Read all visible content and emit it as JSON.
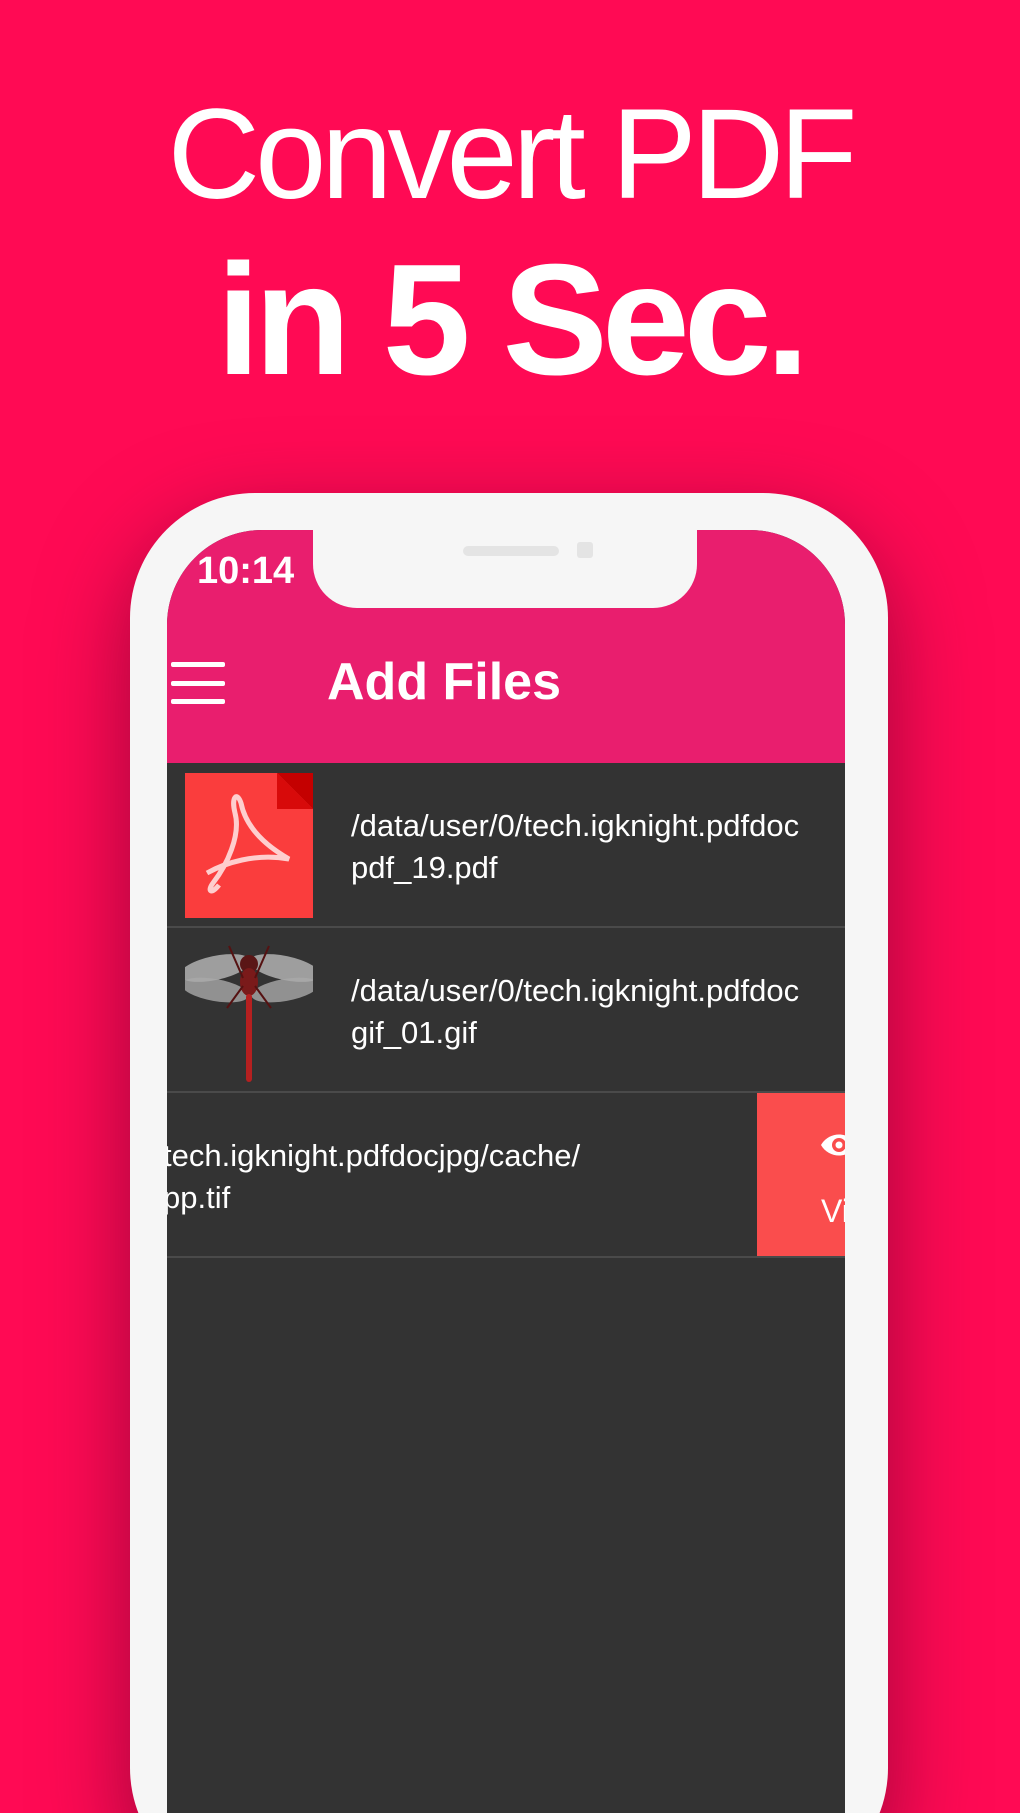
{
  "headline": {
    "line1": "Convert PDF",
    "line2": "in 5 Sec."
  },
  "statusbar": {
    "time": "10:14"
  },
  "toolbar": {
    "title": "Add Files",
    "menu_icon": "hamburger-icon"
  },
  "files": [
    {
      "thumb": "pdf-file-icon",
      "line1": "/data/user/0/tech.igknight.pdfdoc",
      "line2": "pdf_19.pdf"
    },
    {
      "thumb": "dragonfly-image",
      "line1": "/data/user/0/tech.igknight.pdfdoc",
      "line2": "gif_01.gif"
    },
    {
      "thumb": "",
      "line1": "tech.igknight.pdfdocjpg/cache/",
      "line2": "pp.tif",
      "swipe_action": {
        "icon": "eye-icon",
        "label": "Vi"
      }
    }
  ],
  "colors": {
    "background": "#ff0a54",
    "app_bar": "#e91e6e",
    "list_bg": "#333333",
    "action": "#fa4d4d"
  }
}
